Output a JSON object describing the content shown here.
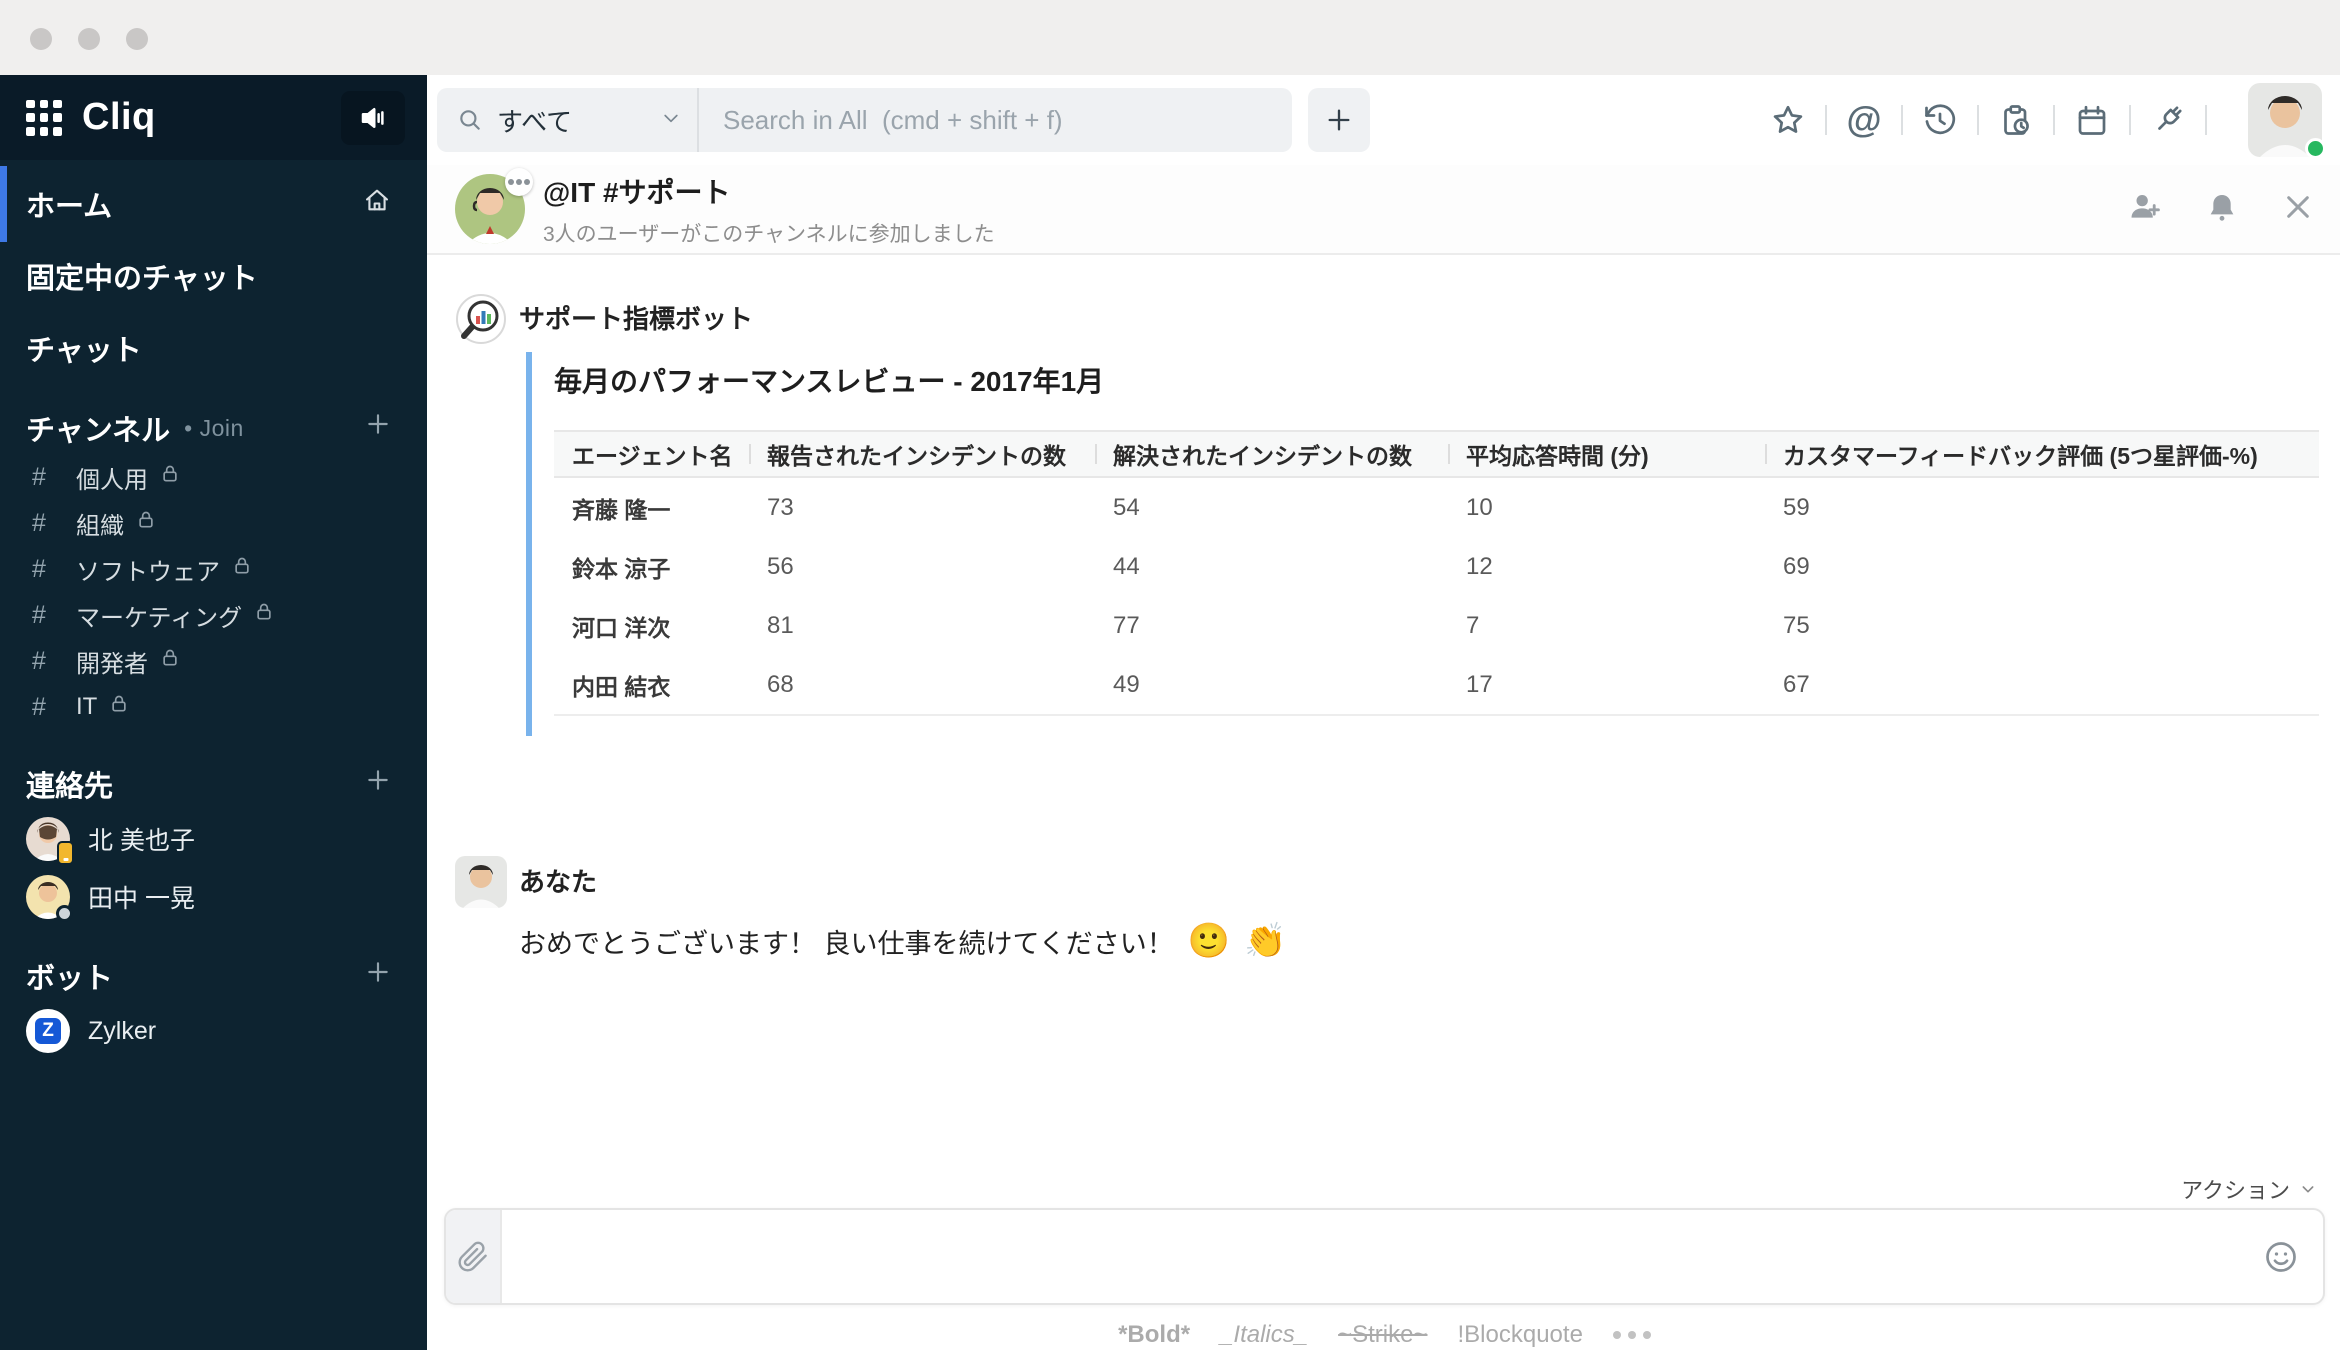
{
  "colors": {
    "sidebar_bg": "#0d2330",
    "sidebar_header_bg": "#0a1b28",
    "active_indicator": "#3e79e6",
    "quote_bar": "#79b3ec",
    "status_online": "#27b860",
    "contact_badge": "#f2b72e",
    "bot_z_blue": "#1558d6"
  },
  "sidebar": {
    "logo": "Cliq",
    "hash_glyph": "#",
    "nav": [
      {
        "label": "ホーム"
      },
      {
        "label": "固定中のチャット"
      },
      {
        "label": "チャット"
      }
    ],
    "channels_header": {
      "label": "チャンネル",
      "join_label": "• Join"
    },
    "channels": [
      {
        "label": "個人用"
      },
      {
        "label": "組織"
      },
      {
        "label": "ソフトウェア"
      },
      {
        "label": "マーケティング"
      },
      {
        "label": "開発者"
      },
      {
        "label": "IT"
      }
    ],
    "contacts_header": "連絡先",
    "contacts": [
      {
        "name": "北 美也子"
      },
      {
        "name": "田中 一晃"
      }
    ],
    "bots_header": "ボット",
    "bots": [
      {
        "name": "Zylker"
      }
    ]
  },
  "topbar": {
    "filter_label": "すべて",
    "search_placeholder": "Search in All  (cmd + shift + f)",
    "at_glyph": "@"
  },
  "channel_header": {
    "title": "@IT #サポート",
    "subtitle": "3人のユーザーがこのチャンネルに参加しました"
  },
  "messages": {
    "bot": {
      "sender": "サポート指標ボット",
      "card_title": "毎月のパフォーマンスレビュー - 2017年1月",
      "table": {
        "headers": [
          "エージェント名",
          "報告されたインシデントの数",
          "解決されたインシデントの数",
          "平均応答時間 (分)",
          "カスタマーフィードバック評価 (5つ星評価-%)"
        ],
        "rows": [
          [
            "斉藤 隆一",
            "73",
            "54",
            "10",
            "59"
          ],
          [
            "鈴本 涼子",
            "56",
            "44",
            "12",
            "69"
          ],
          [
            "河口 洋次",
            "81",
            "77",
            "7",
            "75"
          ],
          [
            "内田 結衣",
            "68",
            "49",
            "17",
            "67"
          ]
        ]
      }
    },
    "user": {
      "sender": "あなた",
      "text": "おめでとうございます！ 良い仕事を続けてください！",
      "emoji_smile": "🙂",
      "emoji_clap": "👏"
    }
  },
  "composer": {
    "actions_label": "アクション",
    "hints": [
      "*Bold*",
      "_Italics_",
      "~Strike~",
      "!Blockquote"
    ]
  }
}
